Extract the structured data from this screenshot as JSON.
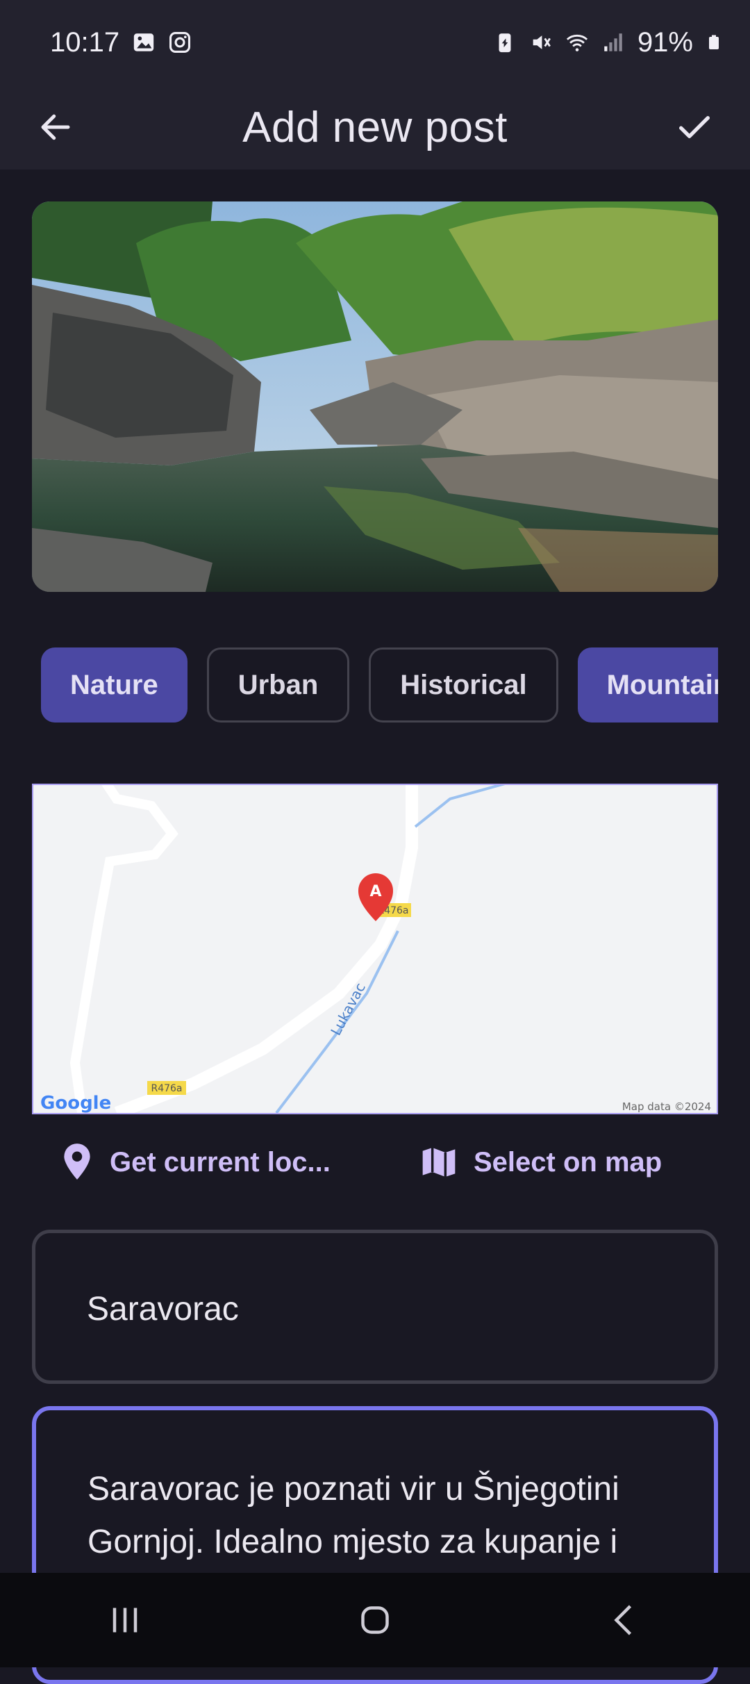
{
  "status_bar": {
    "time": "10:17",
    "battery": "91%",
    "icons": [
      "gallery-icon",
      "instagram-icon",
      "battery-saver-icon",
      "mute-icon",
      "wifi-icon",
      "signal-icon",
      "battery-icon"
    ]
  },
  "app_bar": {
    "title": "Add new post",
    "back_icon": "arrow-left-icon",
    "confirm_icon": "check-icon"
  },
  "categories": [
    {
      "label": "Nature",
      "selected": true
    },
    {
      "label": "Urban",
      "selected": false
    },
    {
      "label": "Historical",
      "selected": false
    },
    {
      "label": "Mountain",
      "selected": true
    }
  ],
  "map": {
    "marker_label": "A",
    "road_label_1": "R476a",
    "road_label_2": "R476a",
    "river_label": "Lukavac",
    "attribution": "Map data ©2024",
    "logo": "Google"
  },
  "location_actions": {
    "current_label": "Get current loc...",
    "select_label": "Select on map"
  },
  "form": {
    "name_value": "Saravorac",
    "description_value": "Saravorac je poznati vir u Šnjegotini Gornjoj. Idealno mjesto za kupanje i uživanje u prirodi."
  },
  "colors": {
    "accent": "#4b48a3",
    "focus_border": "#7a76ee",
    "link": "#cfbef7"
  }
}
